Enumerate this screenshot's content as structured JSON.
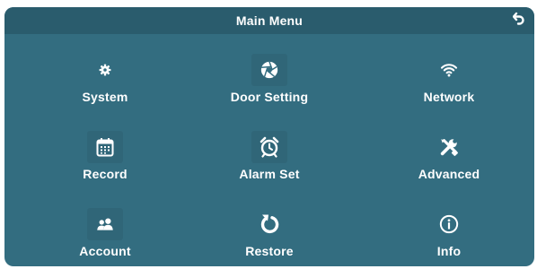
{
  "header": {
    "title": "Main Menu",
    "back_icon": "return-arrow-icon"
  },
  "menu": [
    {
      "label": "System",
      "icon": "gear-icon"
    },
    {
      "label": "Door Setting",
      "icon": "camera-shutter-icon"
    },
    {
      "label": "Network",
      "icon": "wifi-icon"
    },
    {
      "label": "Record",
      "icon": "calendar-icon"
    },
    {
      "label": "Alarm Set",
      "icon": "alarm-clock-icon"
    },
    {
      "label": "Advanced",
      "icon": "tools-icon"
    },
    {
      "label": "Account",
      "icon": "users-icon"
    },
    {
      "label": "Restore",
      "icon": "restore-arrow-icon"
    },
    {
      "label": "Info",
      "icon": "info-icon"
    }
  ],
  "colors": {
    "panel": "#336d80",
    "title_bar": "#2a5c6d",
    "text": "#ffffff"
  }
}
